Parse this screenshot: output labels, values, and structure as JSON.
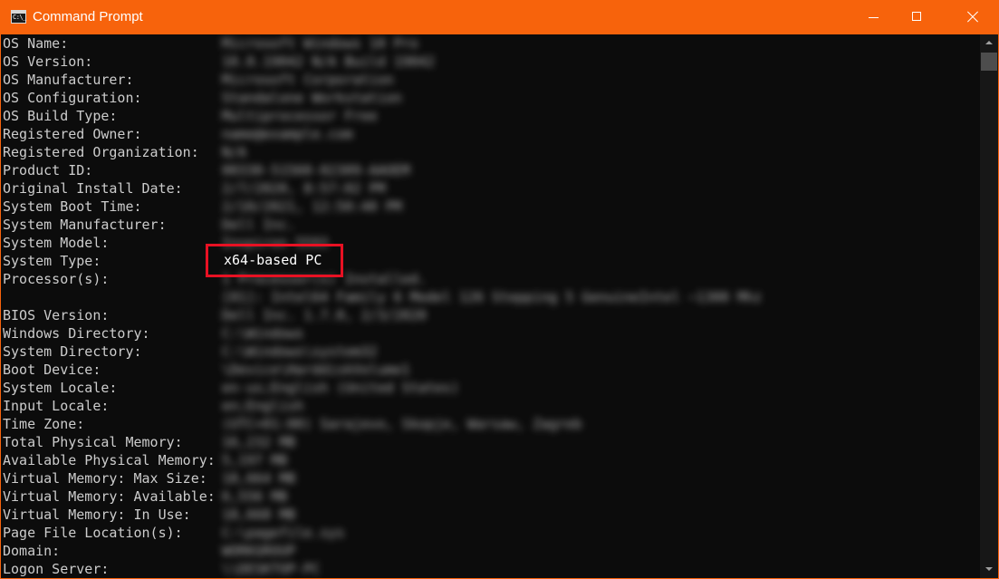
{
  "window": {
    "title": "Command Prompt",
    "icon": "cmd-icon",
    "icon_text": "C:\\_"
  },
  "colors": {
    "titlebar": "#f7630c",
    "console_bg": "#0c0c0c",
    "console_text": "#cccccc",
    "highlight_border": "#e81123"
  },
  "controls": {
    "minimize": "minimize-icon",
    "maximize": "maximize-icon",
    "close": "close-icon"
  },
  "console": {
    "rows": [
      {
        "label": "OS Name:",
        "value": "Microsoft Windows 10 Pro"
      },
      {
        "label": "OS Version:",
        "value": "10.0.19042 N/A Build 19042"
      },
      {
        "label": "OS Manufacturer:",
        "value": "Microsoft Corporation"
      },
      {
        "label": "OS Configuration:",
        "value": "Standalone Workstation"
      },
      {
        "label": "OS Build Type:",
        "value": "Multiprocessor Free"
      },
      {
        "label": "Registered Owner:",
        "value": "name@example.com"
      },
      {
        "label": "Registered Organization:",
        "value": "N/A"
      },
      {
        "label": "Product ID:",
        "value": "00330-51560-02309-AAOEM"
      },
      {
        "label": "Original Install Date:",
        "value": "2/7/2020, 8:57:02 PM"
      },
      {
        "label": "System Boot Time:",
        "value": "2/10/2021, 12:50:40 PM"
      },
      {
        "label": "System Manufacturer:",
        "value": "Dell Inc."
      },
      {
        "label": "System Model:",
        "value": "Inspiron 5593"
      },
      {
        "label": "System Type:",
        "value": ""
      },
      {
        "label": "Processor(s):",
        "value": "1 Processor(s) Installed."
      },
      {
        "label": "",
        "value": "[01]: Intel64 Family 6 Model 126 Stepping 5 GenuineIntel ~1300 Mhz"
      },
      {
        "label": "BIOS Version:",
        "value": "Dell Inc. 1.7.0, 2/3/2020"
      },
      {
        "label": "Windows Directory:",
        "value": "C:\\Windows"
      },
      {
        "label": "System Directory:",
        "value": "C:\\Windows\\system32"
      },
      {
        "label": "Boot Device:",
        "value": "\\Device\\HarddiskVolume1"
      },
      {
        "label": "System Locale:",
        "value": "en-us;English (United States)"
      },
      {
        "label": "Input Locale:",
        "value": "en;English"
      },
      {
        "label": "Time Zone:",
        "value": "(UTC+01:00) Sarajevo, Skopje, Warsaw, Zagreb"
      },
      {
        "label": "Total Physical Memory:",
        "value": "16,232 MB"
      },
      {
        "label": "Available Physical Memory:",
        "value": "5,197 MB"
      },
      {
        "label": "Virtual Memory: Max Size:",
        "value": "18,664 MB"
      },
      {
        "label": "Virtual Memory: Available:",
        "value": "6,556 MB"
      },
      {
        "label": "Virtual Memory: In Use:",
        "value": "18,668 MB"
      },
      {
        "label": "Page File Location(s):",
        "value": "C:\\pagefile.sys"
      },
      {
        "label": "Domain:",
        "value": "WORKGROUP"
      },
      {
        "label": "Logon Server:",
        "value": "\\\\DESKTOP-PC"
      }
    ],
    "highlighted_value": "x64-based PC"
  }
}
